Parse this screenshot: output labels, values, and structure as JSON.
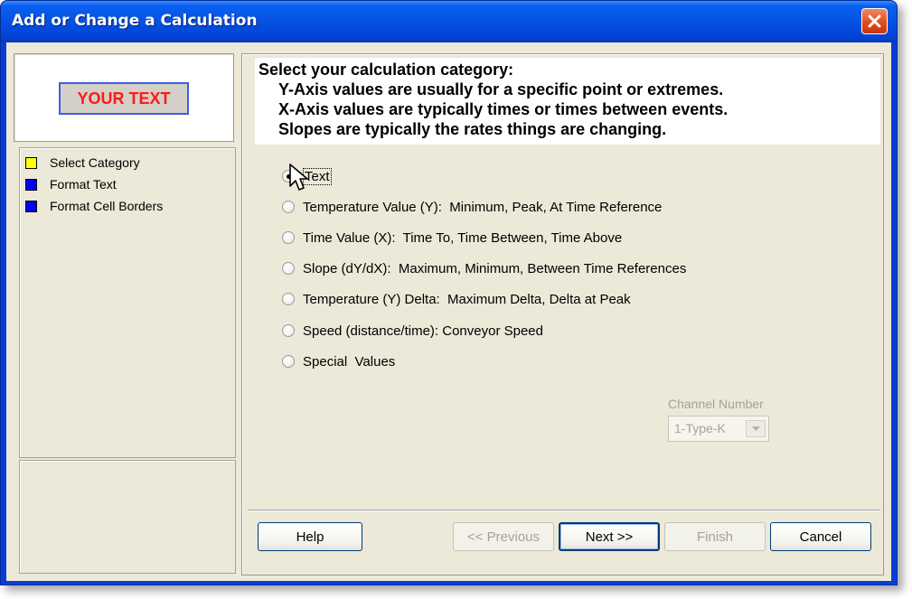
{
  "window": {
    "title": "Add or Change a Calculation"
  },
  "preview": {
    "text": "YOUR TEXT"
  },
  "steps": [
    {
      "label": "Select Category",
      "color": "#ffff00"
    },
    {
      "label": "Format Text",
      "color": "#0000ff"
    },
    {
      "label": "Format Cell Borders",
      "color": "#0000ff"
    }
  ],
  "header": {
    "line1": "Select your calculation category:",
    "line2": "Y-Axis values are usually for a specific point or extremes.",
    "line3": "X-Axis values are typically times or times between events.",
    "line4": "Slopes are typically the rates things are changing."
  },
  "categories": [
    {
      "label": "Text",
      "selected": true
    },
    {
      "label": "Temperature Value (Y):  Minimum, Peak, At Time Reference",
      "selected": false
    },
    {
      "label": "Time Value (X):  Time To, Time Between, Time Above",
      "selected": false
    },
    {
      "label": "Slope (dY/dX):  Maximum, Minimum, Between Time References",
      "selected": false
    },
    {
      "label": "Temperature (Y) Delta:  Maximum Delta, Delta at Peak",
      "selected": false
    },
    {
      "label": "Speed (distance/time): Conveyor Speed",
      "selected": false
    },
    {
      "label": "Special  Values",
      "selected": false
    }
  ],
  "channel": {
    "label": "Channel Number",
    "value": "1-Type-K"
  },
  "buttons": {
    "help": "Help",
    "previous": "<< Previous",
    "next": "Next >>",
    "finish": "Finish",
    "cancel": "Cancel"
  },
  "colors": {
    "titlebar": "#0552e3",
    "dialog_bg": "#ece9d8",
    "preview_text": "#ff1a1a",
    "close_button": "#e04c1c"
  },
  "icons": {
    "close": "close-icon",
    "cursor": "cursor-arrow-icon",
    "dropdown": "chevron-down-icon"
  }
}
